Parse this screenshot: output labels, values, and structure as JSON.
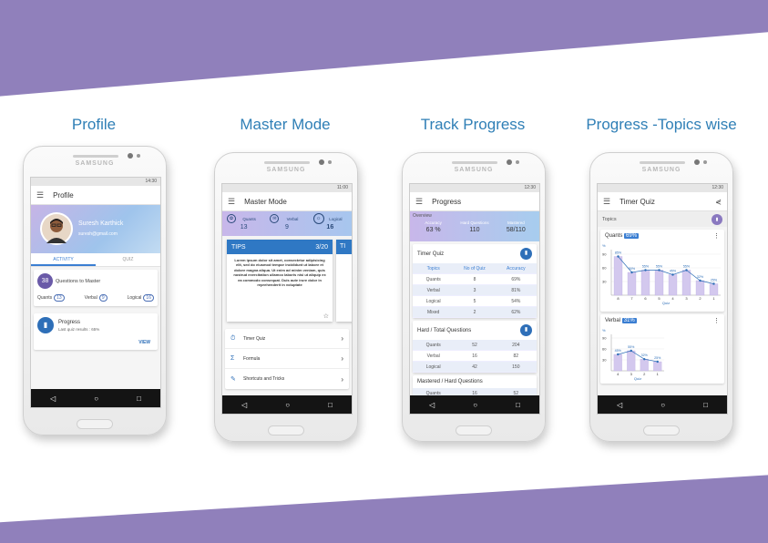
{
  "panels": [
    "Profile",
    "Master Mode",
    "Track Progress",
    "Progress -Topics wise"
  ],
  "device_brand": "SAMSUNG",
  "colors": {
    "band": "#9080bb",
    "title": "#2f7fb6",
    "accent": "#2e6fb8"
  },
  "nav_icons": [
    "back-icon",
    "home-icon",
    "recents-icon"
  ],
  "nav_glyphs": {
    "back": "◁",
    "home": "○",
    "recents": "□"
  },
  "profile": {
    "status_time": "14:30",
    "appbar_title": "Profile",
    "user_name": "Suresh Karthick",
    "user_email": "suresh@gmail.com",
    "tabs": [
      "ACTIVITY",
      "QUIZ"
    ],
    "questions_count": "38",
    "questions_label": "Questions to Master",
    "stats": [
      {
        "label": "Quants",
        "value": "13"
      },
      {
        "label": "Verbal",
        "value": "9"
      },
      {
        "label": "Logical",
        "value": "16"
      }
    ],
    "progress_title": "Progress",
    "progress_sub": "Last quiz results : 65%",
    "view_label": "VIEW"
  },
  "master": {
    "status_time": "11:00",
    "appbar_title": "Master Mode",
    "topics": [
      {
        "label": "Quants",
        "value": "13"
      },
      {
        "label": "Verbal",
        "value": "9"
      },
      {
        "label": "Logical",
        "value": "16"
      }
    ],
    "tip_title": "TIPS",
    "tip_counter": "3/20",
    "tip_next_label": "TI",
    "tip_text": "Lorem ipsum dolor sit amet, consectetur adipisicing elit, sed do eiusmod tempor incididunt ut labore et dolore magna aliqua. Ut enim ad minim veniam, quis nostrud exercitation ullamco laboris nisi ut aliquip ex ea commodo consequat. Duis aute irure dolor in reprehenderit in voluptate",
    "menu": [
      {
        "label": "Timer Quiz",
        "icon": "timer-icon",
        "glyph": "⏱"
      },
      {
        "label": "Formula",
        "icon": "sigma-icon",
        "glyph": "Σ"
      },
      {
        "label": "Shortcuts and Tricks",
        "icon": "wand-icon",
        "glyph": "✎"
      }
    ],
    "chevron": "›"
  },
  "track": {
    "status_time": "12:30",
    "appbar_title": "Progress",
    "overview_label": "Overview",
    "overview": [
      {
        "label": "Accuracy",
        "value": "63 %"
      },
      {
        "label": "Hard Questions",
        "value": "110"
      },
      {
        "label": "Mastered",
        "value": "58/110"
      }
    ],
    "timer_title": "Timer Quiz",
    "timer_headers": [
      "Topics",
      "No of Quiz",
      "Accuracy"
    ],
    "timer_rows": [
      [
        "Quants",
        "8",
        "69%"
      ],
      [
        "Verbal",
        "3",
        "81%"
      ],
      [
        "Logical",
        "5",
        "54%"
      ],
      [
        "Mixed",
        "2",
        "62%"
      ]
    ],
    "hard_title": "Hard / Total Questions",
    "hard_rows": [
      [
        "Quants",
        "52",
        "204"
      ],
      [
        "Verbal",
        "16",
        "82"
      ],
      [
        "Logical",
        "42",
        "150"
      ]
    ],
    "mastered_title": "Mastered / Hard Questions",
    "mastered_rows": [
      [
        "Quants",
        "16",
        "52"
      ]
    ]
  },
  "topics": {
    "status_time": "12:30",
    "appbar_title": "Timer Quiz",
    "topics_label": "Topics",
    "share_icon": "share-icon",
    "cards": [
      {
        "name": "Quants",
        "pct": "69%",
        "xlabel": "Quiz",
        "ylabel": "%"
      },
      {
        "name": "Verbal",
        "pct": "31%",
        "xlabel": "Quiz",
        "ylabel": "%"
      }
    ]
  },
  "chart_data": [
    {
      "type": "bar",
      "title": "Quants 69%",
      "xlabel": "Quiz",
      "ylabel": "%",
      "ylim": [
        0,
        100
      ],
      "yticks": [
        "90",
        "60",
        "30"
      ],
      "categories": [
        "8",
        "7",
        "6",
        "5",
        "4",
        "3",
        "2",
        "1"
      ],
      "values": [
        85,
        50,
        55,
        55,
        45,
        55,
        32,
        25
      ],
      "labels": [
        "85%",
        "50%",
        "55%",
        "55%",
        "45%",
        "55%",
        "32%",
        "25%"
      ]
    },
    {
      "type": "bar",
      "title": "Verbal 31%",
      "xlabel": "Quiz",
      "ylabel": "%",
      "ylim": [
        0,
        100
      ],
      "yticks": [
        "90",
        "60",
        "30"
      ],
      "categories": [
        "4",
        "3",
        "2",
        "1"
      ],
      "values": [
        45,
        55,
        32,
        25
      ],
      "labels": [
        "45%",
        "55%",
        "32%",
        "25%"
      ]
    }
  ]
}
